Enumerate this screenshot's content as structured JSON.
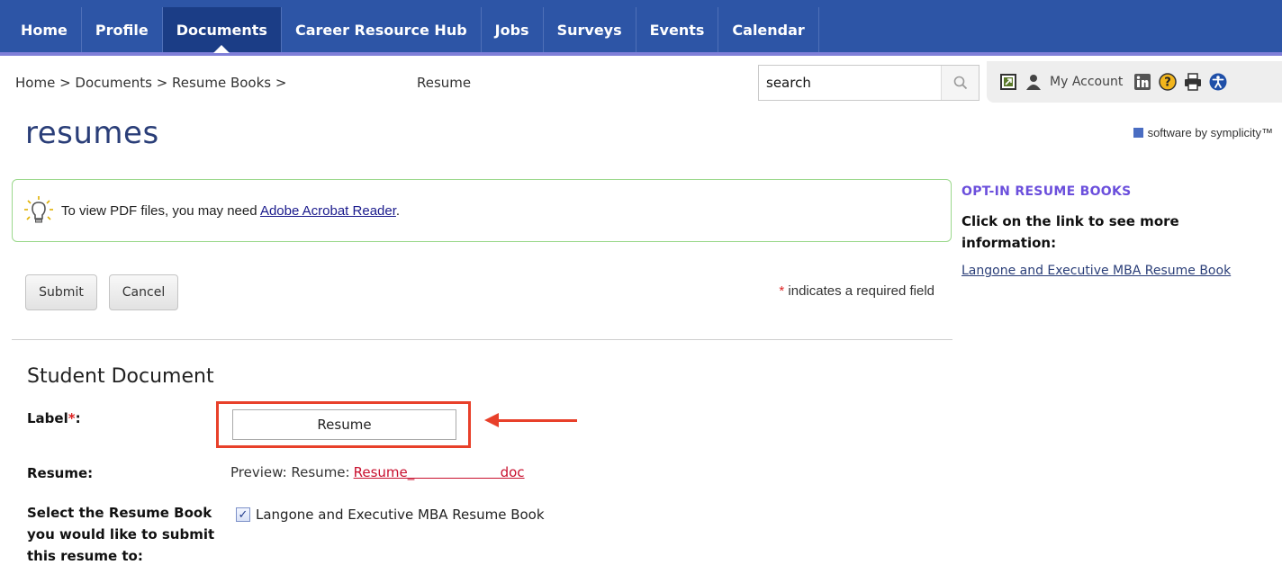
{
  "nav": {
    "items": [
      {
        "label": "Home",
        "active": false
      },
      {
        "label": "Profile",
        "active": false
      },
      {
        "label": "Documents",
        "active": true
      },
      {
        "label": "Career Resource Hub",
        "active": false
      },
      {
        "label": "Jobs",
        "active": false
      },
      {
        "label": "Surveys",
        "active": false
      },
      {
        "label": "Events",
        "active": false
      },
      {
        "label": "Calendar",
        "active": false
      }
    ]
  },
  "breadcrumb": {
    "path": "Home > Documents > Resume Books >",
    "current": "Resume"
  },
  "search": {
    "value": "search"
  },
  "toolbar": {
    "my_account": "My Account"
  },
  "page": {
    "title": "resumes",
    "software": "software by symplicity™"
  },
  "notice": {
    "text": "To view PDF files, you may need",
    "link": "Adobe Acrobat Reader",
    "suffix": "."
  },
  "buttons": {
    "submit": "Submit",
    "cancel": "Cancel"
  },
  "required_note": {
    "star": "*",
    "text": " indicates a required field"
  },
  "form": {
    "section_title": "Student Document",
    "label_field": {
      "label": "Label",
      "required": "*",
      "colon": ":",
      "value": "Resume"
    },
    "resume": {
      "label": "Resume:",
      "preview_prefix": "Preview: Resume:",
      "preview_link": "Resume_                    doc"
    },
    "resume_book": {
      "label": "Select the Resume Book you would like to submit this resume to:",
      "checkbox_label": "Langone and Executive MBA Resume Book",
      "checked": true
    }
  },
  "sidebar": {
    "title": "OPT-IN RESUME BOOKS",
    "subtitle": "Click on the link to see more information:",
    "link": "Langone and Executive MBA Resume Book"
  },
  "colors": {
    "nav_bg": "#2d55a6",
    "nav_active": "#1b3d86",
    "highlight": "#e8402a",
    "notice_border": "#9bd88c",
    "link_red": "#c8102e"
  }
}
